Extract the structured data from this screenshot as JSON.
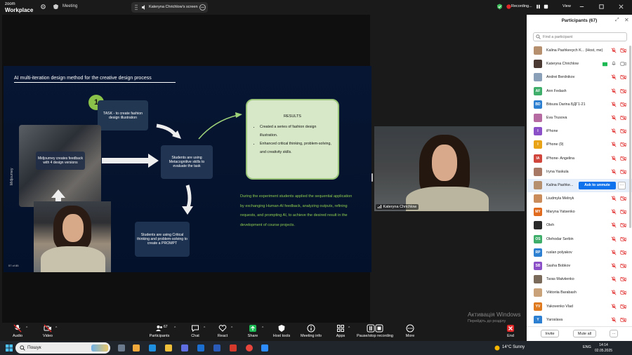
{
  "app": {
    "logo_line1": "zoom",
    "logo_line2": "Workplace",
    "meeting_label": "Meeting",
    "share_indicator": "Kateryna Chrichlow's screen",
    "recording_label": "Recording...",
    "view_label": "View"
  },
  "slide": {
    "title": "AI multi-iteration design method for the creative design process",
    "step_number": "1",
    "task_box": "TASK - to create fashion design illustration",
    "students_box_1": "Students are using Metacognitive skills to evaluate the task",
    "students_box_2": "Students are using Critical thinking and problem-solving to create a PROMPT",
    "midjourney_box": "Midjourney creates feedback with 4 design versions",
    "midjourney_vertical": "Midjourney",
    "results_title": "RESULTS",
    "results_items": [
      "Created a series of fashion design illustration.",
      "Enhanced critical thinking, problem-solving, and creativity skills."
    ],
    "green_text": "During the experiment students applied the sequential application by exchanging Human-AI feedback, analyzing outputs, refining requests, and prompting AI, to achieve the desired result in the development of course projects.",
    "page_number": "57 of 85"
  },
  "camera": {
    "name": "Kateryna Chrichlow"
  },
  "watermark": {
    "line1": "Активація Windows",
    "line2": "Перейдіть до розділу \"Настройки\", щоб активувати Windows."
  },
  "participants": {
    "title": "Participants (67)",
    "search_placeholder": "Find a participant",
    "ask_unmute_label": "Ask to unmute",
    "invite_label": "Invite",
    "mute_all_label": "Mute all",
    "list": [
      {
        "name": "Kalina Pashkevych K... (Host, me)",
        "initials": "",
        "color": "#b58f6e",
        "video": false
      },
      {
        "name": "Kateryna Chrichlow",
        "initials": "",
        "color": "#4a3a33",
        "video": true
      },
      {
        "name": "Andrei Berdnikov",
        "initials": "",
        "color": "#8aa0b8",
        "video": false
      },
      {
        "name": "Ann Fedash",
        "initials": "AF",
        "color": "#3fae6a",
        "video": false
      },
      {
        "name": "Bitsura Darina БДГ1-21",
        "initials": "BD",
        "color": "#2d7fd1",
        "video": false
      },
      {
        "name": "Eva Trusova",
        "initials": "",
        "color": "#b56aa1",
        "video": false
      },
      {
        "name": "iPhone",
        "initials": "I",
        "color": "#8b4fc7",
        "video": false
      },
      {
        "name": "iPhone (9)",
        "initials": "I",
        "color": "#e8a317",
        "video": false
      },
      {
        "name": "iPhone- Angelina",
        "initials": "IA",
        "color": "#d0463c",
        "video": false
      },
      {
        "name": "Iryna Yaskula",
        "initials": "",
        "color": "#a87a66",
        "video": false
      },
      {
        "name": "Kalina Pashke...",
        "initials": "",
        "color": "#b58f6e",
        "video": false,
        "highlight": true
      },
      {
        "name": "Liudmyla Melnyk",
        "initials": "",
        "color": "#c98c5a",
        "video": false
      },
      {
        "name": "Maryna Yatsenko",
        "initials": "MY",
        "color": "#e06b1f",
        "video": false
      },
      {
        "name": "Oleh",
        "initials": "",
        "color": "#2a2a2a",
        "video": false
      },
      {
        "name": "Olehodar Serbin",
        "initials": "OS",
        "color": "#3fae6a",
        "video": false
      },
      {
        "name": "ruslan polyakov",
        "initials": "RP",
        "color": "#2d7fd1",
        "video": false
      },
      {
        "name": "Sasha Bobkov",
        "initials": "SB",
        "color": "#8b4fc7",
        "video": false
      },
      {
        "name": "Taras Matviienko",
        "initials": "",
        "color": "#7a6a5a",
        "video": false
      },
      {
        "name": "Viktoriia Barabash",
        "initials": "",
        "color": "#c9a27a",
        "video": false
      },
      {
        "name": "Yakovenko Vlad",
        "initials": "YV",
        "color": "#e07a1f",
        "video": false
      },
      {
        "name": "Yaroslava",
        "initials": "Y",
        "color": "#2d7fd1",
        "video": false
      }
    ]
  },
  "toolbar": {
    "audio": "Audio",
    "video": "Video",
    "participants": "Participants",
    "participants_count": "67",
    "chat": "Chat",
    "react": "React",
    "share": "Share",
    "host_tools": "Host tools",
    "meeting_info": "Meeting info",
    "apps": "Apps",
    "pause_recording": "Pause/stop recording",
    "more": "More",
    "end": "End"
  },
  "taskbar": {
    "search_text": "Пошук",
    "weather": "14°C  Sunny",
    "language": "ENG",
    "time": "14:14",
    "date": "02.05.2025"
  },
  "colors": {
    "zoom_blue": "#0e72ed",
    "muted_red": "#e02828",
    "green_text": "#8fce4f",
    "end_red": "#e02828"
  }
}
